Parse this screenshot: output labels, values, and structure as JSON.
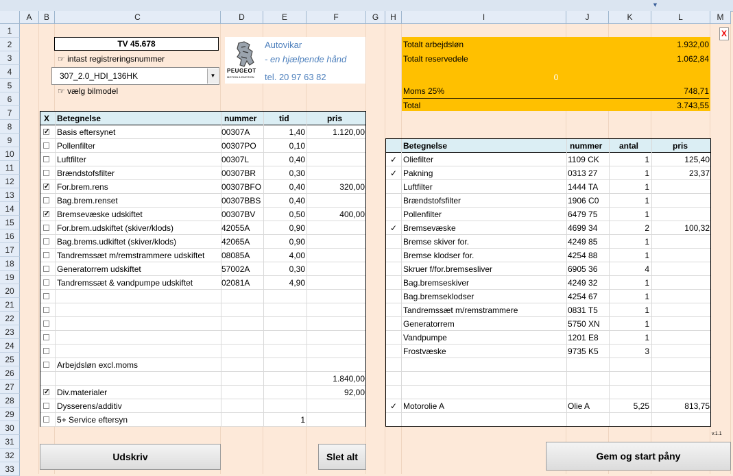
{
  "columns": [
    "A",
    "B",
    "C",
    "D",
    "E",
    "F",
    "G",
    "H",
    "I",
    "J",
    "K",
    "L",
    "M"
  ],
  "rows": [
    "1",
    "2",
    "3",
    "4",
    "5",
    "6",
    "7",
    "8",
    "9",
    "10",
    "11",
    "12",
    "13",
    "14",
    "15",
    "16",
    "17",
    "18",
    "19",
    "20",
    "21",
    "22",
    "23",
    "24",
    "25",
    "26",
    "27",
    "28",
    "29",
    "30",
    "31",
    "32",
    "33"
  ],
  "plate": "TV 45.678",
  "plate_hint": "intast registreringsnummer",
  "model_value": "307_2.0_HDI_136HK",
  "model_hint": "vælg bilmodel",
  "dealer": {
    "name": "Autovikar",
    "tagline": "- en hjælpende hånd",
    "phone": "tel. 20 97 63 82",
    "logo_text": "PEUGEOT",
    "logo_sub": "MOTION & EMOTION"
  },
  "summary": {
    "labor_label": "Totalt arbejdsløn",
    "labor_value": "1.932,00",
    "parts_label": "Totalt reservedele",
    "parts_value": "1.062,84",
    "zero": "0",
    "vat_label": "Moms 25%",
    "vat_value": "748,71",
    "total_label": "Total",
    "total_value": "3.743,55"
  },
  "close_label": "X",
  "jobs": {
    "headers": {
      "x": "X",
      "name": "Betegnelse",
      "number": "nummer",
      "time": "tid",
      "price": "pris"
    },
    "rows": [
      {
        "checked": true,
        "name": "Basis eftersynet",
        "number": "00307A",
        "time": "1,40",
        "price": "1.120,00"
      },
      {
        "checked": false,
        "name": "Pollenfilter",
        "number": "00307PO",
        "time": "0,10",
        "price": ""
      },
      {
        "checked": false,
        "name": "Luftfilter",
        "number": "00307L",
        "time": "0,40",
        "price": ""
      },
      {
        "checked": false,
        "name": "Brændstofsfilter",
        "number": "00307BR",
        "time": "0,30",
        "price": ""
      },
      {
        "checked": true,
        "name": "For.brem.rens",
        "number": "00307BFO",
        "time": "0,40",
        "price": "320,00"
      },
      {
        "checked": false,
        "name": "Bag.brem.renset",
        "number": "00307BBS",
        "time": "0,40",
        "price": ""
      },
      {
        "checked": true,
        "name": "Bremsevæske udskiftet",
        "number": "00307BV",
        "time": "0,50",
        "price": "400,00"
      },
      {
        "checked": false,
        "name": "For.brem.udskiftet (skiver/klods)",
        "number": "42055A",
        "time": "0,90",
        "price": ""
      },
      {
        "checked": false,
        "name": "Bag.brems.udkiftet (skiver/klods)",
        "number": "42065A",
        "time": "0,90",
        "price": ""
      },
      {
        "checked": false,
        "name": "Tandremssæt m/remstrammere udskiftet",
        "number": "08085A",
        "time": "4,00",
        "price": ""
      },
      {
        "checked": false,
        "name": "Generatorrem udskiftet",
        "number": "57002A",
        "time": "0,30",
        "price": ""
      },
      {
        "checked": false,
        "name": "Tandremssæt & vandpumpe udskiftet",
        "number": "02081A",
        "time": "4,90",
        "price": ""
      },
      {
        "checked": false,
        "name": "",
        "number": "",
        "time": "",
        "price": ""
      },
      {
        "checked": false,
        "name": "",
        "number": "",
        "time": "",
        "price": ""
      },
      {
        "checked": false,
        "name": "",
        "number": "",
        "time": "",
        "price": ""
      },
      {
        "checked": false,
        "name": "",
        "number": "",
        "time": "",
        "price": ""
      },
      {
        "checked": false,
        "name": "",
        "number": "",
        "time": "",
        "price": ""
      },
      {
        "checked": false,
        "name": "Arbejdsløn excl.moms",
        "number": "",
        "time": "",
        "price": ""
      },
      {
        "checked": null,
        "name": "",
        "number": "",
        "time": "",
        "price": "1.840,00"
      },
      {
        "checked": true,
        "name": "Div.materialer",
        "number": "",
        "time": "",
        "price": "92,00"
      },
      {
        "checked": false,
        "name": "Dysserens/additiv",
        "number": "",
        "time": "",
        "price": ""
      },
      {
        "checked": false,
        "name": "5+ Service eftersyn",
        "number": "",
        "time": "1",
        "price": ""
      }
    ]
  },
  "parts": {
    "headers": {
      "name": "Betegnelse",
      "number": "nummer",
      "qty": "antal",
      "price": "pris"
    },
    "rows": [
      {
        "checked": true,
        "name": "Oliefilter",
        "number": "1109 CK",
        "qty": "1",
        "price": "125,40"
      },
      {
        "checked": true,
        "name": "Pakning",
        "number": "0313 27",
        "qty": "1",
        "price": "23,37"
      },
      {
        "checked": false,
        "name": "Luftfilter",
        "number": "1444 TA",
        "qty": "1",
        "price": ""
      },
      {
        "checked": false,
        "name": "Brændstofsfilter",
        "number": "1906 C0",
        "qty": "1",
        "price": ""
      },
      {
        "checked": false,
        "name": "Pollenfilter",
        "number": "6479 75",
        "qty": "1",
        "price": ""
      },
      {
        "checked": true,
        "name": "Bremsevæske",
        "number": "4699 34",
        "qty": "2",
        "price": "100,32"
      },
      {
        "checked": false,
        "name": "Bremse skiver for.",
        "number": "4249 85",
        "qty": "1",
        "price": ""
      },
      {
        "checked": false,
        "name": "Bremse klodser for.",
        "number": "4254 88",
        "qty": "1",
        "price": ""
      },
      {
        "checked": false,
        "name": "Skruer f/for.bremsesliver",
        "number": "6905 36",
        "qty": "4",
        "price": ""
      },
      {
        "checked": false,
        "name": "Bag.bremseskiver",
        "number": "4249 32",
        "qty": "1",
        "price": ""
      },
      {
        "checked": false,
        "name": "Bag.bremseklodser",
        "number": "4254 67",
        "qty": "1",
        "price": ""
      },
      {
        "checked": false,
        "name": "Tandremssæt m/remstrammere",
        "number": "0831 T5",
        "qty": "1",
        "price": ""
      },
      {
        "checked": false,
        "name": "Generatorrem",
        "number": "5750 XN",
        "qty": "1",
        "price": ""
      },
      {
        "checked": false,
        "name": "Vandpumpe",
        "number": "1201 E8",
        "qty": "1",
        "price": ""
      },
      {
        "checked": false,
        "name": "Frostvæske",
        "number": "9735 K5",
        "qty": "3",
        "price": ""
      },
      {
        "checked": false,
        "name": "",
        "number": "",
        "qty": "",
        "price": ""
      },
      {
        "checked": false,
        "name": "",
        "number": "",
        "qty": "",
        "price": ""
      },
      {
        "checked": false,
        "name": "",
        "number": "",
        "qty": "",
        "price": ""
      },
      {
        "checked": true,
        "name": "Motorolie A",
        "number": "Olie A",
        "qty": "5,25",
        "price": "813,75"
      }
    ]
  },
  "buttons": {
    "print": "Udskriv",
    "clear": "Slet alt",
    "save": "Gem og start påny"
  },
  "version": "v.1.1"
}
